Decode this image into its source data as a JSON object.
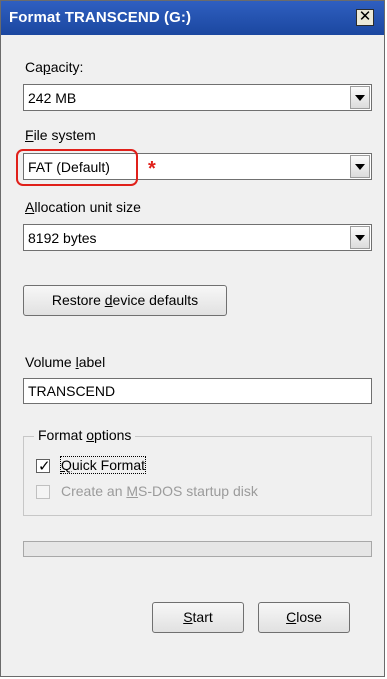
{
  "window": {
    "title": "Format TRANSCEND (G:)",
    "close_glyph": "✕"
  },
  "capacity": {
    "label_pre": "Ca",
    "label_key": "p",
    "label_post": "acity:",
    "value": "242 MB"
  },
  "file_system": {
    "label_key": "F",
    "label_post": "ile system",
    "value": "FAT (Default)",
    "marker": "*",
    "highlight_color": "#e0201a"
  },
  "allocation": {
    "label_key": "A",
    "label_post": "llocation unit size",
    "value": "8192 bytes"
  },
  "restore_button": {
    "label_pre": "Restore ",
    "label_key": "d",
    "label_post": "evice defaults"
  },
  "volume": {
    "label_pre": "Volume ",
    "label_key": "l",
    "label_post": "abel",
    "value": "TRANSCEND"
  },
  "format_options": {
    "legend_pre": "Format ",
    "legend_key": "o",
    "legend_post": "ptions",
    "quick_format": {
      "checked": true,
      "check_glyph": "✓",
      "label_key": "Q",
      "label_post": "uick Format"
    },
    "msdos_disk": {
      "checked": false,
      "enabled": false,
      "label_pre": "Create an ",
      "label_key": "M",
      "label_post": "S-DOS startup disk"
    }
  },
  "progress": {
    "value": 0
  },
  "buttons": {
    "start_key": "S",
    "start_post": "tart",
    "close_key": "C",
    "close_post": "lose"
  }
}
